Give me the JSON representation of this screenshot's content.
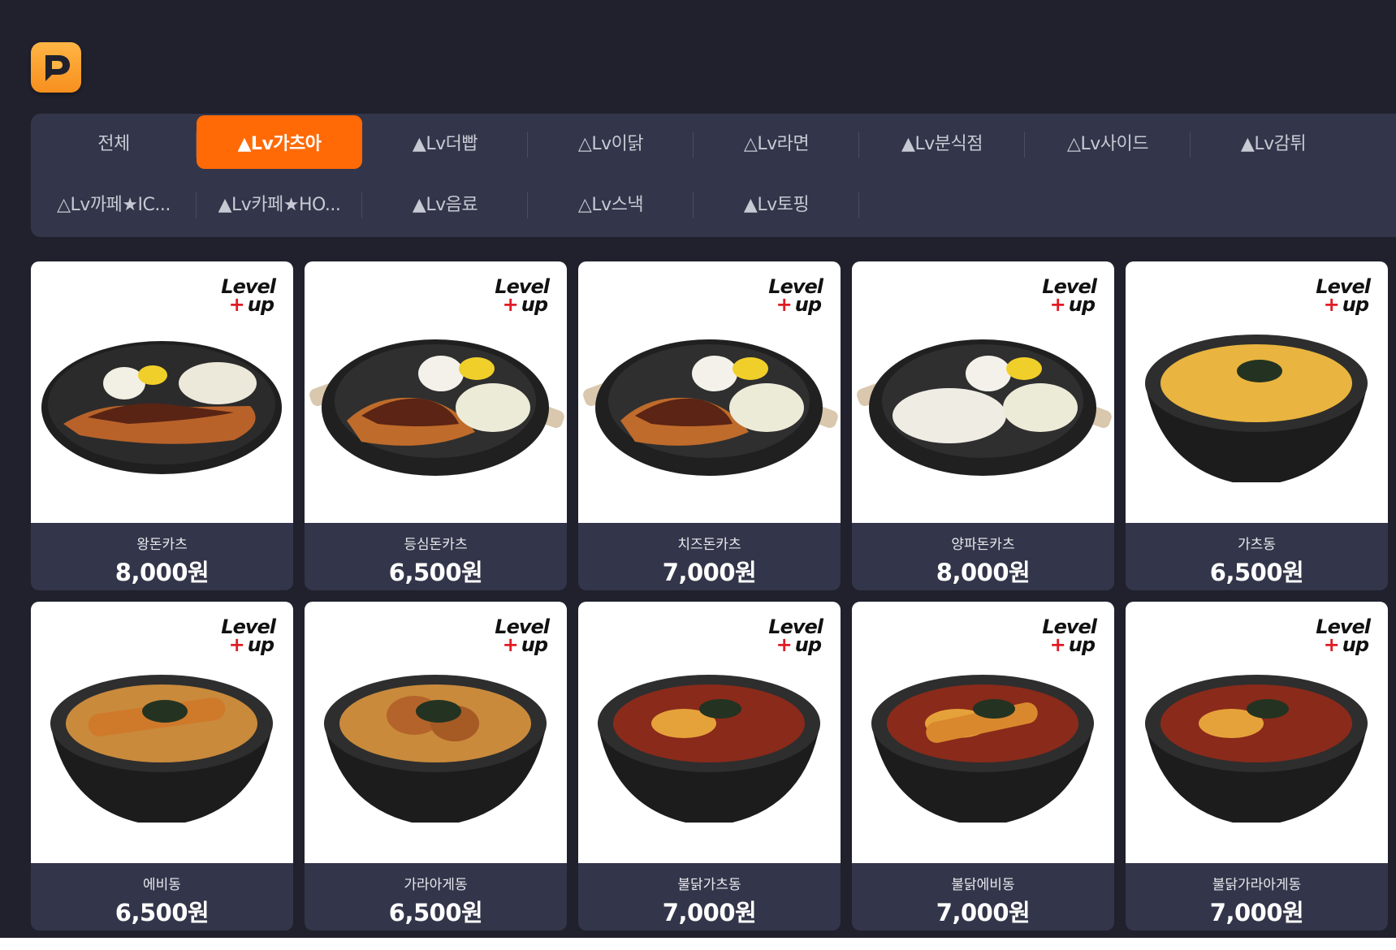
{
  "app": {
    "logo_icon": "app-logo-icon",
    "accent": "#ff6a07",
    "background": "#20212d",
    "panel": "#33364a"
  },
  "categories": {
    "row1": [
      {
        "label": "전체",
        "active": false
      },
      {
        "label": "▲Lv가츠아",
        "active": true
      },
      {
        "label": "▲Lv더빱",
        "active": false
      },
      {
        "label": "△Lv이닭",
        "active": false
      },
      {
        "label": "△Lv라면",
        "active": false
      },
      {
        "label": "▲Lv분식점",
        "active": false
      },
      {
        "label": "△Lv사이드",
        "active": false
      },
      {
        "label": "▲Lv감튀",
        "active": false
      }
    ],
    "row2": [
      {
        "label": "△Lv까페★IC...",
        "active": false
      },
      {
        "label": "▲Lv카페★HO...",
        "active": false
      },
      {
        "label": "▲Lv음료",
        "active": false
      },
      {
        "label": "△Lv스낵",
        "active": false
      },
      {
        "label": "▲Lv토핑",
        "active": false
      }
    ]
  },
  "brand_mark": {
    "line1": "Level",
    "line2": "up"
  },
  "menu": [
    {
      "name": "왕돈카츠",
      "price": "8,000원",
      "image": "plate-katsu"
    },
    {
      "name": "등심돈카츠",
      "price": "6,500원",
      "image": "pan-katsu"
    },
    {
      "name": "치즈돈카츠",
      "price": "7,000원",
      "image": "pan-katsu"
    },
    {
      "name": "양파돈카츠",
      "price": "8,000원",
      "image": "pan-onion-katsu"
    },
    {
      "name": "가츠동",
      "price": "6,500원",
      "image": "bowl-katsudon"
    },
    {
      "name": "에비동",
      "price": "6,500원",
      "image": "bowl-ebidon"
    },
    {
      "name": "가라아게동",
      "price": "6,500원",
      "image": "bowl-karaage"
    },
    {
      "name": "불닭가츠동",
      "price": "7,000원",
      "image": "bowl-spicy"
    },
    {
      "name": "불닭에비동",
      "price": "7,000원",
      "image": "bowl-spicy-ebi"
    },
    {
      "name": "불닭가라아게동",
      "price": "7,000원",
      "image": "bowl-spicy-karaage"
    }
  ]
}
